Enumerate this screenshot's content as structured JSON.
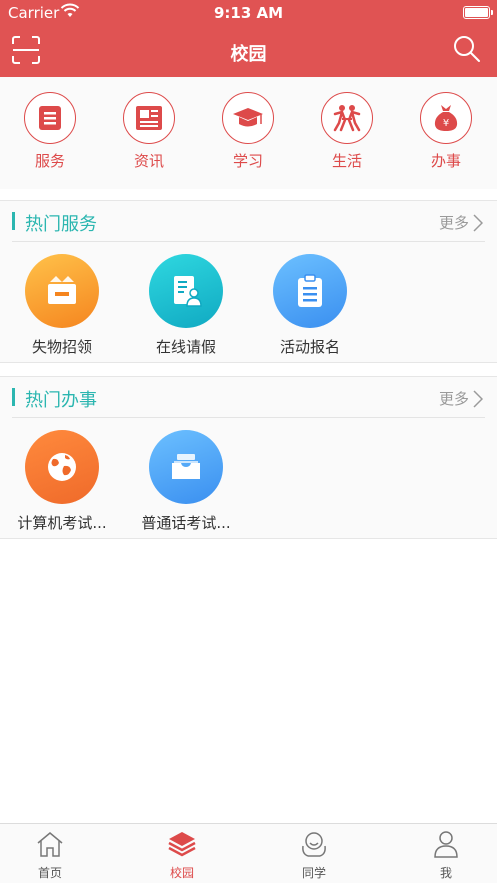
{
  "status_bar": {
    "carrier": "Carrier",
    "time": "9:13 AM"
  },
  "nav": {
    "title": "校园",
    "left_icon": "scan-icon",
    "right_icon": "search-icon"
  },
  "categories": [
    {
      "label": "服务",
      "icon": "service-icon"
    },
    {
      "label": "资讯",
      "icon": "news-icon"
    },
    {
      "label": "学习",
      "icon": "graduation-cap-icon"
    },
    {
      "label": "生活",
      "icon": "life-icon"
    },
    {
      "label": "办事",
      "icon": "money-bag-icon"
    }
  ],
  "hot_services": {
    "title": "热门服务",
    "more": "更多",
    "items": [
      {
        "label": "失物招领",
        "icon": "box-icon"
      },
      {
        "label": "在线请假",
        "icon": "leave-form-icon"
      },
      {
        "label": "活动报名",
        "icon": "clipboard-icon"
      }
    ]
  },
  "hot_affairs": {
    "title": "热门办事",
    "more": "更多",
    "items": [
      {
        "label": "计算机考试...",
        "icon": "globe-icon"
      },
      {
        "label": "普通话考试...",
        "icon": "inbox-icon"
      }
    ]
  },
  "tabbar": [
    {
      "label": "首页",
      "icon": "home-icon",
      "active": false
    },
    {
      "label": "校园",
      "icon": "layers-icon",
      "active": true
    },
    {
      "label": "同学",
      "icon": "classmates-icon",
      "active": false
    },
    {
      "label": "我",
      "icon": "person-icon",
      "active": false
    }
  ],
  "colors": {
    "primary": "#e05353",
    "accent": "#2bb6b0",
    "background": "#ffffff"
  }
}
